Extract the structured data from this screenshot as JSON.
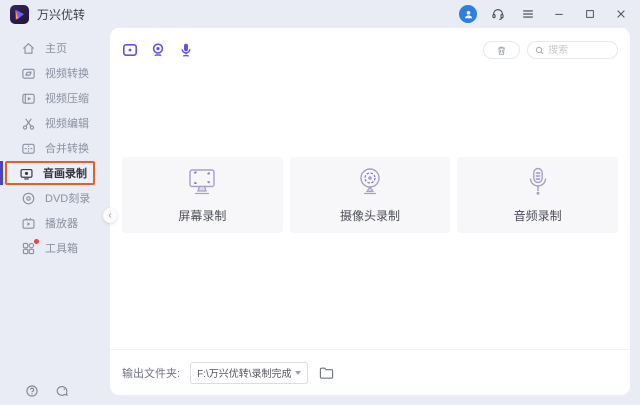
{
  "window": {
    "title": "万兴优转"
  },
  "sidebar": {
    "items": [
      {
        "label": "主页",
        "icon": "home"
      },
      {
        "label": "视频转换",
        "icon": "video-convert"
      },
      {
        "label": "视频压缩",
        "icon": "video-compress"
      },
      {
        "label": "视频编辑",
        "icon": "scissors"
      },
      {
        "label": "合并转换",
        "icon": "merge"
      },
      {
        "label": "音画录制",
        "icon": "screen-record",
        "selected": true,
        "highlight_border": "#e0622b"
      },
      {
        "label": "DVD刻录",
        "icon": "dvd-disc"
      },
      {
        "label": "播放器",
        "icon": "player"
      },
      {
        "label": "工具箱",
        "icon": "toolbox-grid",
        "badge": true
      }
    ]
  },
  "content": {
    "toolbar": {
      "tabs": [
        {
          "name": "screen-record-tab"
        },
        {
          "name": "webcam-record-tab"
        },
        {
          "name": "audio-record-tab"
        }
      ],
      "search_placeholder": "搜索"
    },
    "cards": [
      {
        "label": "屏幕录制",
        "icon": "monitor"
      },
      {
        "label": "摄像头录制",
        "icon": "webcam"
      },
      {
        "label": "音频录制",
        "icon": "microphone"
      }
    ],
    "footer": {
      "label": "输出文件夹:",
      "path": "F:\\万兴优转\\录制完成"
    }
  },
  "colors": {
    "accent_purple": "#6053e0",
    "highlight_border": "#e0622b",
    "avatar_blue": "#2e7fe0",
    "badge_red": "#e8433f"
  }
}
